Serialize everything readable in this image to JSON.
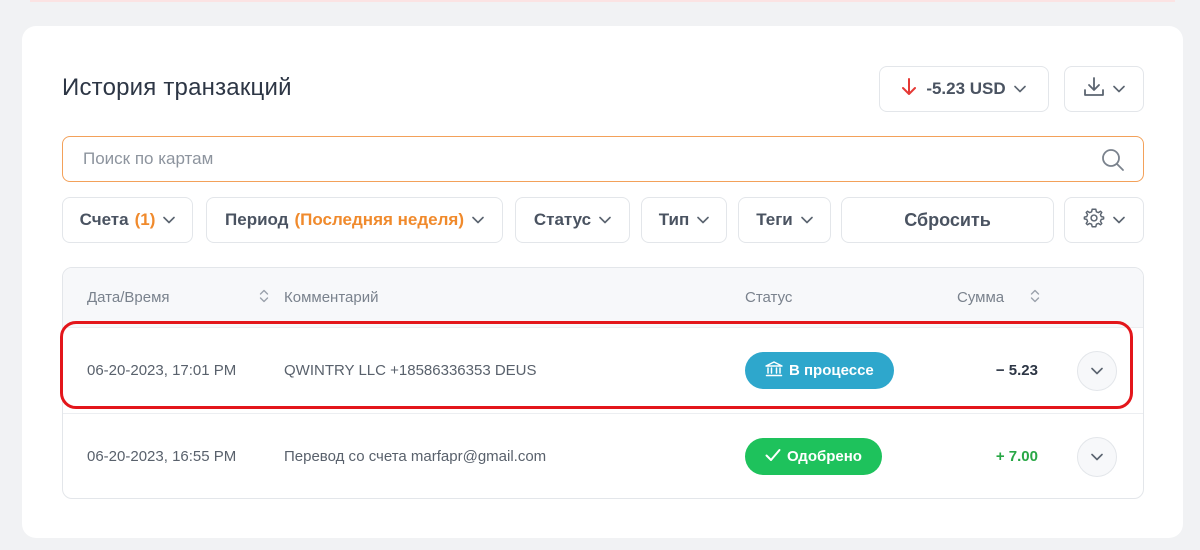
{
  "card": {
    "title": "История транзакций",
    "balance": {
      "value": "-5.23 USD",
      "direction_icon": "arrow-down-icon",
      "color": "#e53935"
    },
    "download_icon": "download-icon"
  },
  "search": {
    "placeholder": "Поиск по картам",
    "value": ""
  },
  "filters": {
    "accounts_label": "Счета",
    "accounts_count": "(1)",
    "period_label": "Период",
    "period_value": "(Последняя неделя)",
    "status_label": "Статус",
    "type_label": "Тип",
    "tags_label": "Теги",
    "reset_label": "Сбросить",
    "settings_icon": "gear-icon"
  },
  "table": {
    "headers": {
      "datetime": "Дата/Время",
      "comment": "Комментарий",
      "status": "Статус",
      "amount": "Сумма"
    },
    "rows": [
      {
        "datetime": "06-20-2023, 17:01 PM",
        "comment": "QWINTRY LLC +18586336353 DEUS",
        "status": "В процессе",
        "status_icon": "bank-icon",
        "status_color": "#2ea7cc",
        "amount": "− 5.23"
      },
      {
        "datetime": "06-20-2023, 16:55 PM",
        "comment": "Перевод со счета marfapr@gmail.com",
        "status": "Одобрено",
        "status_icon": "check-icon",
        "status_color": "#1ec25c",
        "amount": "+ 7.00"
      }
    ]
  },
  "colors": {
    "accent": "#f08a2c",
    "highlight": "#e3161b"
  }
}
